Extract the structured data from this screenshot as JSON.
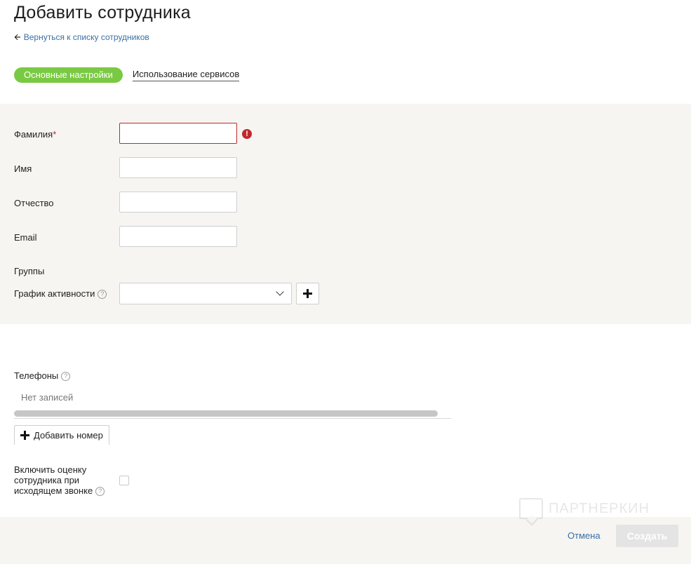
{
  "header": {
    "title": "Добавить сотрудника",
    "back_link": "Вернуться к списку сотрудников"
  },
  "tabs": [
    {
      "label": "Основные настройки",
      "active": true
    },
    {
      "label": "Использование сервисов",
      "active": false
    }
  ],
  "form": {
    "last_name": {
      "label": "Фамилия",
      "required_mark": "*",
      "value": "",
      "error": true,
      "error_icon": "!"
    },
    "first_name": {
      "label": "Имя",
      "value": ""
    },
    "middle_name": {
      "label": "Отчество",
      "value": ""
    },
    "email": {
      "label": "Email",
      "value": ""
    },
    "groups": {
      "label": "Группы"
    },
    "activity_schedule": {
      "label": "График активности",
      "help_icon": "?",
      "selected": ""
    }
  },
  "phones": {
    "label": "Телефоны",
    "help_icon": "?",
    "empty_text": "Нет записей",
    "add_button": "Добавить номер"
  },
  "evaluation": {
    "label": "Включить оценку сотрудника при исходящем звонке",
    "help_icon": "?",
    "checked": false
  },
  "watermark": {
    "text": "ПАРТНЕРКИН"
  },
  "footer": {
    "cancel": "Отмена",
    "create": "Создать"
  },
  "colors": {
    "accent_green": "#7ac943",
    "link_blue": "#3a6fa6",
    "error_red": "#c0282d",
    "panel_bg": "#f6f5f2"
  }
}
